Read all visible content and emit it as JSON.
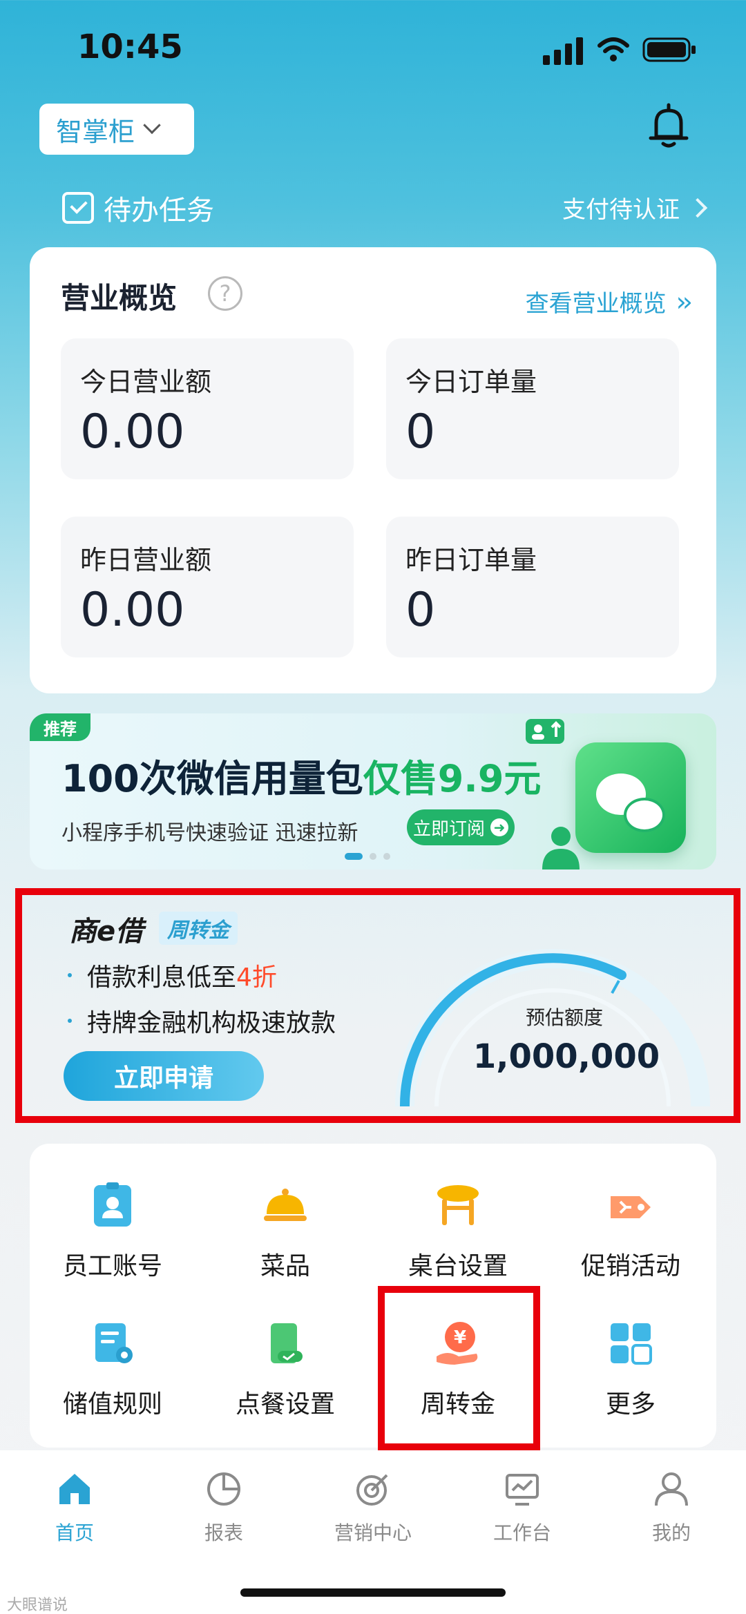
{
  "status_bar": {
    "time": "10:45"
  },
  "header": {
    "store_name": "智掌柜",
    "todo_label": "待办任务",
    "payment_link": "支付待认证"
  },
  "overview": {
    "title": "营业概览",
    "help_glyph": "?",
    "view_all_label": "查看营业概览",
    "stats": [
      {
        "label": "今日营业额",
        "value": "0.00"
      },
      {
        "label": "今日订单量",
        "value": "0"
      },
      {
        "label": "昨日营业额",
        "value": "0.00"
      },
      {
        "label": "昨日订单量",
        "value": "0"
      }
    ]
  },
  "banner": {
    "tag": "推荐",
    "headline_main": "100次微信用量包",
    "headline_highlight": "仅售9.9元",
    "subtext": "小程序手机号快速验证 迅速拉新",
    "button_label": "立即订阅"
  },
  "loan": {
    "brand": "商e借",
    "tag": "周转金",
    "bullet1_prefix": "借款利息低至",
    "bullet1_highlight": "4折",
    "bullet2": "持牌金融机构极速放款",
    "apply_label": "立即申请",
    "estimate_label": "预估额度",
    "estimate_value": "1,000,000"
  },
  "menu": {
    "items": [
      {
        "label": "员工账号"
      },
      {
        "label": "菜品"
      },
      {
        "label": "桌台设置"
      },
      {
        "label": "促销活动"
      },
      {
        "label": "储值规则"
      },
      {
        "label": "点餐设置"
      },
      {
        "label": "周转金"
      },
      {
        "label": "更多"
      }
    ]
  },
  "tabbar": {
    "tabs": [
      {
        "label": "首页"
      },
      {
        "label": "报表"
      },
      {
        "label": "营销中心"
      },
      {
        "label": "工作台"
      },
      {
        "label": "我的"
      }
    ]
  },
  "watermark": "大眼谱说",
  "colors": {
    "accent": "#2aa3d3",
    "highlight_frame": "#e8000b",
    "promo_green": "#19b462",
    "discount_red": "#ff4a2a"
  }
}
